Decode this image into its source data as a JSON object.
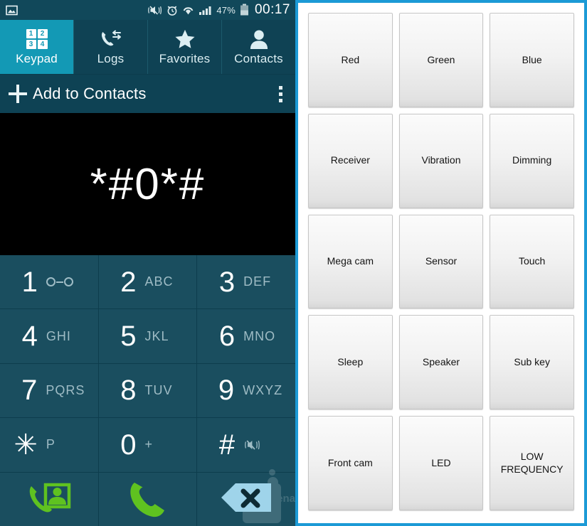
{
  "phone": {
    "statusbar": {
      "left_icons": [
        "image-icon"
      ],
      "right_icons": [
        "vibrate-mute-icon",
        "alarm-icon",
        "wifi-icon",
        "signal-icon"
      ],
      "battery_percent": "47%",
      "clock": "00:17"
    },
    "tabs": [
      {
        "label": "Keypad",
        "icon": "keypad-grid-icon",
        "active": true,
        "digits": [
          "1",
          "2",
          "3",
          "4"
        ]
      },
      {
        "label": "Logs",
        "icon": "call-log-icon",
        "active": false
      },
      {
        "label": "Favorites",
        "icon": "star-icon",
        "active": false
      },
      {
        "label": "Contacts",
        "icon": "person-icon",
        "active": false
      }
    ],
    "actionbar": {
      "add_label": "Add to Contacts",
      "add_icon": "plus-icon",
      "overflow_icon": "overflow-menu-icon"
    },
    "display": {
      "dialed_number": "*#0*#"
    },
    "keys": [
      {
        "digit": "1",
        "letters": "",
        "icon": "voicemail-icon"
      },
      {
        "digit": "2",
        "letters": "ABC",
        "icon": ""
      },
      {
        "digit": "3",
        "letters": "DEF",
        "icon": ""
      },
      {
        "digit": "4",
        "letters": "GHI",
        "icon": ""
      },
      {
        "digit": "5",
        "letters": "JKL",
        "icon": ""
      },
      {
        "digit": "6",
        "letters": "MNO",
        "icon": ""
      },
      {
        "digit": "7",
        "letters": "PQRS",
        "icon": ""
      },
      {
        "digit": "8",
        "letters": "TUV",
        "icon": ""
      },
      {
        "digit": "9",
        "letters": "WXYZ",
        "icon": ""
      },
      {
        "digit": "✳",
        "letters": "P",
        "icon": ""
      },
      {
        "digit": "0",
        "letters": "+",
        "icon": ""
      },
      {
        "digit": "#",
        "letters": "",
        "icon": "vibrate-mute-icon"
      }
    ],
    "action_keys": [
      {
        "name": "video-call-button",
        "icon": "video-call-icon"
      },
      {
        "name": "call-button",
        "icon": "phone-handset-icon"
      },
      {
        "name": "backspace-button",
        "icon": "backspace-icon"
      }
    ],
    "watermark": "PhoneArena",
    "colors": {
      "status_bar": "#11485a",
      "tab_bar": "#0f4254",
      "tab_active": "#1399b5",
      "key_bg": "#1a4e5f",
      "display_bg": "#000000",
      "call_green": "#5fc220",
      "backspace_blue": "#9fd4ea"
    }
  },
  "service_menu": {
    "border_color": "#1c9ad6",
    "buttons": [
      "Red",
      "Green",
      "Blue",
      "Receiver",
      "Vibration",
      "Dimming",
      "Mega cam",
      "Sensor",
      "Touch",
      "Sleep",
      "Speaker",
      "Sub key",
      "Front cam",
      "LED",
      "LOW\nFREQUENCY"
    ]
  }
}
